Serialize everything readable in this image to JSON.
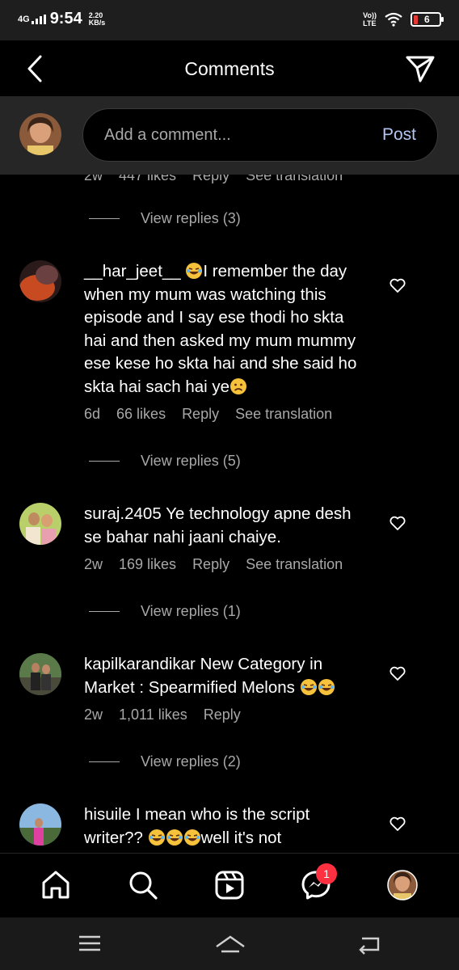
{
  "status_bar": {
    "network": "4G",
    "time": "9:54",
    "speed_value": "2.20",
    "speed_unit": "KB/s",
    "volte_top": "Vo))",
    "volte_bottom": "LTE",
    "battery": "6"
  },
  "header": {
    "title": "Comments"
  },
  "composer": {
    "placeholder": "Add a comment...",
    "post_label": "Post"
  },
  "partial_comment": {
    "time": "2w",
    "likes": "447 likes",
    "reply": "Reply",
    "translation": "See translation",
    "view_replies": "View replies (3)"
  },
  "comments": [
    {
      "username": "__har_jeet__",
      "text_before_emoji": "",
      "text": "I remember the day when my mum was watching this episode and I say ese thodi ho skta hai and then asked my mum mummy ese kese ho skta hai and she said ho skta hai sach hai ye",
      "time": "6d",
      "likes": "66 likes",
      "reply": "Reply",
      "translation": "See translation",
      "view_replies": "View replies (5)"
    },
    {
      "username": "suraj.2405",
      "text": "Ye technology apne desh se bahar nahi jaani chaiye.",
      "time": "2w",
      "likes": "169 likes",
      "reply": "Reply",
      "translation": "See translation",
      "view_replies": "View replies (1)"
    },
    {
      "username": "kapilkarandikar",
      "text": "New Category in Market : Spearmified Melons",
      "time": "2w",
      "likes": "1,011 likes",
      "reply": "Reply",
      "view_replies": "View replies (2)"
    },
    {
      "username": "hisuile",
      "text_part1": "I mean who is the script writer??",
      "text_part2": "well it's not"
    }
  ],
  "bottom_nav": {
    "messenger_badge": "1",
    "items": [
      "home-icon",
      "search-icon",
      "reels-icon",
      "messenger-icon",
      "profile-avatar"
    ]
  },
  "colors": {
    "background": "#000000",
    "composer_bg": "#262626",
    "secondary_text": "#a8a8a8",
    "post_link": "#b3c6f2",
    "badge": "#ff3040",
    "battery_low": "#e53935"
  }
}
